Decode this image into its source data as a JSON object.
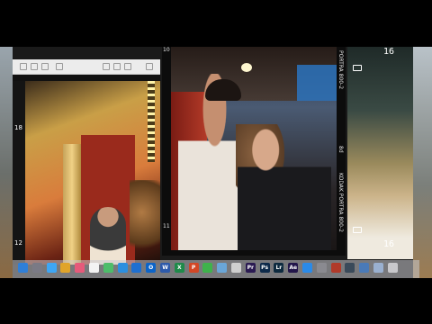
{
  "photo_left": {
    "film_labels": [
      "18",
      "12"
    ]
  },
  "photo_main": {
    "edge_labels_left": [
      "10",
      "11"
    ],
    "edge_labels_right": [
      "PORTRA 800-2",
      "KODAK PORTRA 800-2",
      "8d",
      "18"
    ]
  },
  "photo_right": {
    "film_number_top": "16",
    "film_number_bottom": "16"
  },
  "dock": {
    "apps": [
      {
        "name": "finder-icon",
        "label": "",
        "color": "#2f7fd8"
      },
      {
        "name": "launchpad-icon",
        "label": "",
        "color": "#7a7a85"
      },
      {
        "name": "messages-icon",
        "label": "",
        "color": "#3da6f5"
      },
      {
        "name": "chrome-icon",
        "label": "",
        "color": "#e0a42a"
      },
      {
        "name": "photos-icon",
        "label": "",
        "color": "#e65a7a"
      },
      {
        "name": "calendar-icon",
        "label": "",
        "color": "#f3f3f3"
      },
      {
        "name": "notes-icon",
        "label": "",
        "color": "#4dbd6a"
      },
      {
        "name": "safari-icon",
        "label": "",
        "color": "#2b8fe0"
      },
      {
        "name": "onedrive-icon",
        "label": "",
        "color": "#1e6fd0"
      },
      {
        "name": "outlook-icon",
        "label": "O",
        "color": "#0c64c8"
      },
      {
        "name": "word-icon",
        "label": "W",
        "color": "#2d5aaa"
      },
      {
        "name": "excel-icon",
        "label": "X",
        "color": "#1f8a4a"
      },
      {
        "name": "powerpoint-icon",
        "label": "P",
        "color": "#d24726"
      },
      {
        "name": "facetime-icon",
        "label": "",
        "color": "#3fb24c"
      },
      {
        "name": "preview-icon",
        "label": "",
        "color": "#6aa6d8"
      },
      {
        "name": "finalcut-icon",
        "label": "",
        "color": "#cfcfcf"
      },
      {
        "name": "premiere-icon",
        "label": "Pr",
        "color": "#2a1a52"
      },
      {
        "name": "photoshop-icon",
        "label": "Ps",
        "color": "#0d2a4a"
      },
      {
        "name": "lightroom-icon",
        "label": "Lr",
        "color": "#0d2a3f"
      },
      {
        "name": "aftereffects-icon",
        "label": "Ae",
        "color": "#22164a"
      },
      {
        "name": "appstore-icon",
        "label": "",
        "color": "#2a8ae8"
      },
      {
        "name": "settings-icon",
        "label": "",
        "color": "#8a8a90"
      },
      {
        "name": "capture-one-icon",
        "label": "",
        "color": "#b03a2a"
      },
      {
        "name": "quicktime-icon",
        "label": "",
        "color": "#3a4a5a"
      },
      {
        "name": "screen-recorder-icon",
        "label": "",
        "color": "#4a7ab8"
      },
      {
        "name": "downloads-icon",
        "label": "",
        "color": "#9ab0d0"
      },
      {
        "name": "trash-icon",
        "label": "",
        "color": "#c8c8cc"
      }
    ]
  }
}
